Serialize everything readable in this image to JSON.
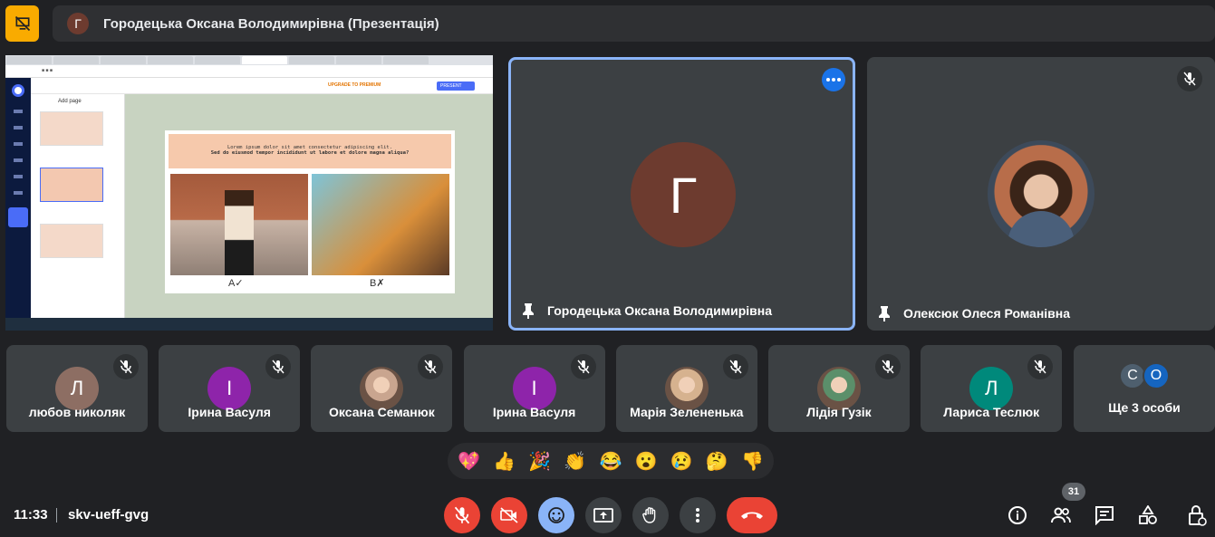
{
  "meeting": {
    "presenter_title": "Городецька Оксана Володимирівна (Презентація)",
    "presenter_initial": "Г",
    "time": "11:33",
    "code": "skv-ueff-gvg",
    "participants_count": "31"
  },
  "colors": {
    "accent_yellow": "#f9ab00",
    "end_red": "#ea4335",
    "active_blue": "#8ab4f8",
    "tile_bg": "#3c4043",
    "page_bg": "#202124"
  },
  "screenshare": {
    "card_title": "Lorem ipsum dolor sit amet consectetur adipiscing elit.",
    "card_subtitle": "Sed do eiusmod tempor incididunt ut labore et dolore magna aliqua?",
    "label_a": "A✓",
    "label_b": "B✗",
    "add_page": "Add page",
    "upgrade": "UPGRADE TO PREMIUM",
    "present": "PRESENT"
  },
  "main_tiles": [
    {
      "name": "Городецька Оксана Володимирівна",
      "initial": "Г"
    },
    {
      "name": "Олексюк Олеся Романівна"
    }
  ],
  "small_tiles": [
    {
      "name": "любов николяк",
      "initial": "Л",
      "color": "#8d6e63"
    },
    {
      "name": "Ірина Васуля",
      "initial": "І",
      "color": "#8e24aa"
    },
    {
      "name": "Оксана Семанюк",
      "initial": "",
      "color": "#c9a58f"
    },
    {
      "name": "Ірина Васуля",
      "initial": "І",
      "color": "#8e24aa"
    },
    {
      "name": "Марія Зелененька",
      "initial": "",
      "color": "#d6b28f"
    },
    {
      "name": "Лідія Гузік",
      "initial": "",
      "color": "#5b8f6a"
    },
    {
      "name": "Лариса Теслюк",
      "initial": "Л",
      "color": "#00897b"
    }
  ],
  "others_tile": {
    "label": "Ще 3 особи",
    "initials": [
      "С",
      "О"
    ]
  },
  "reactions": [
    "💖",
    "👍",
    "🎉",
    "👏",
    "😂",
    "😮",
    "😢",
    "🤔",
    "👎"
  ],
  "icons": [
    "present-off-icon",
    "pin-icon",
    "mic-off-icon",
    "more-icon",
    "camera-off-icon",
    "emoji-icon",
    "present-screen-icon",
    "raise-hand-icon",
    "end-call-icon",
    "info-icon",
    "people-icon",
    "chat-icon",
    "activities-icon",
    "host-controls-icon"
  ]
}
